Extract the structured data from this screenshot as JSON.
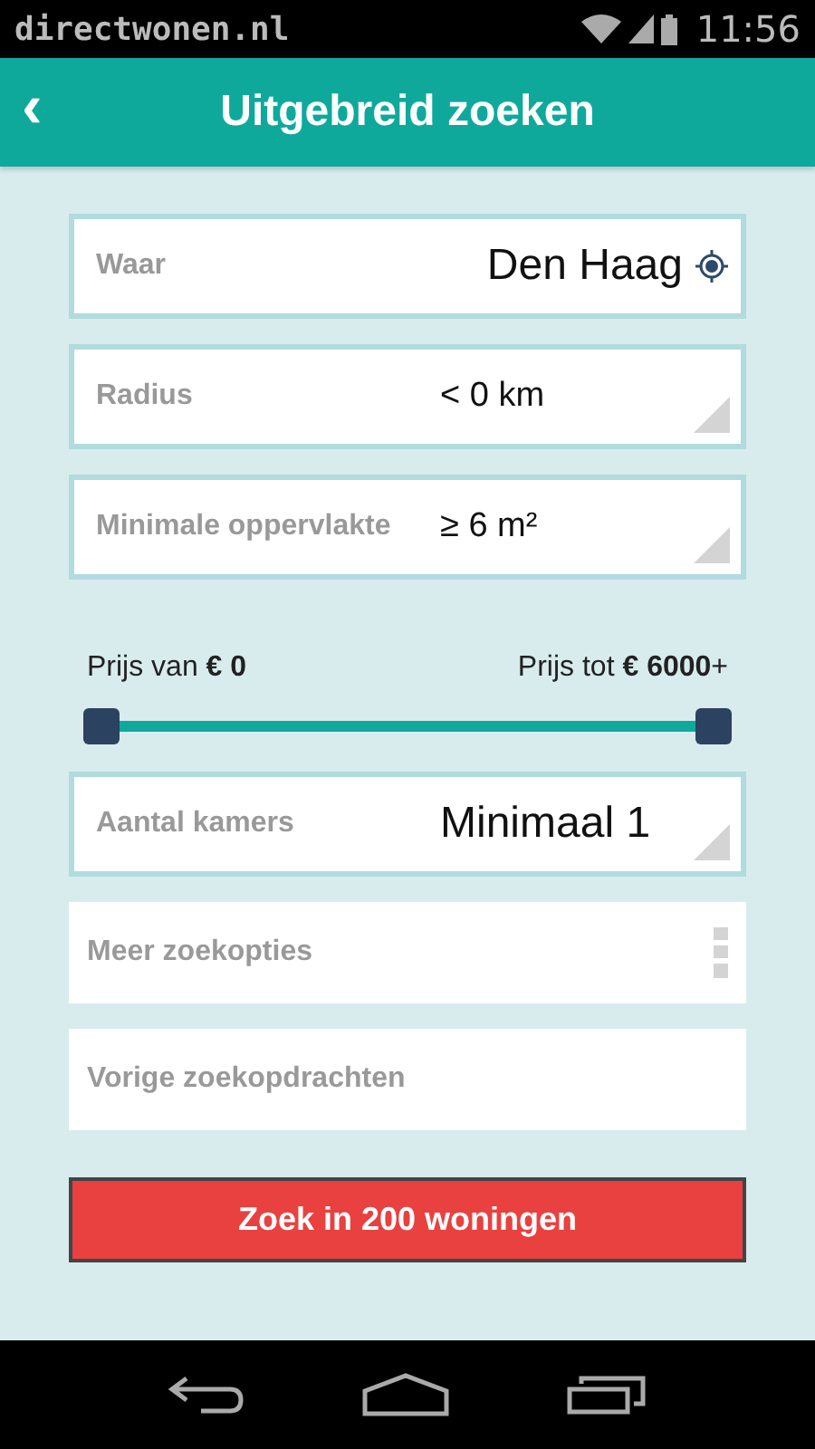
{
  "status_bar": {
    "app": "directwonen.nl",
    "time": "11:56"
  },
  "header": {
    "back": "‹",
    "title": "Uitgebreid zoeken"
  },
  "fields": [
    {
      "kind": "location",
      "label": "Waar",
      "value": "Den Haag"
    },
    {
      "kind": "dropdown",
      "label": "Radius",
      "value": "< 0 km"
    },
    {
      "kind": "dropdown",
      "label": "Minimale oppervlakte",
      "value": "≥ 6 m²"
    }
  ],
  "price": {
    "from": "Prijs van **€ 0**",
    "to": "Prijs tot **€ 6000**+",
    "thumbs": [
      {
        "level": 0
      },
      {
        "level": 1
      }
    ]
  },
  "rooms": {
    "kind": "dropdown",
    "label": "Aantal kamers",
    "value": "Minimaal 1"
  },
  "options": [
    {
      "kind": "menu",
      "label": "Meer zoekopties"
    },
    {
      "kind": "plain",
      "label": "Vorige zoekopdrachten"
    }
  ],
  "search_button": "Zoek in 200 woningen"
}
